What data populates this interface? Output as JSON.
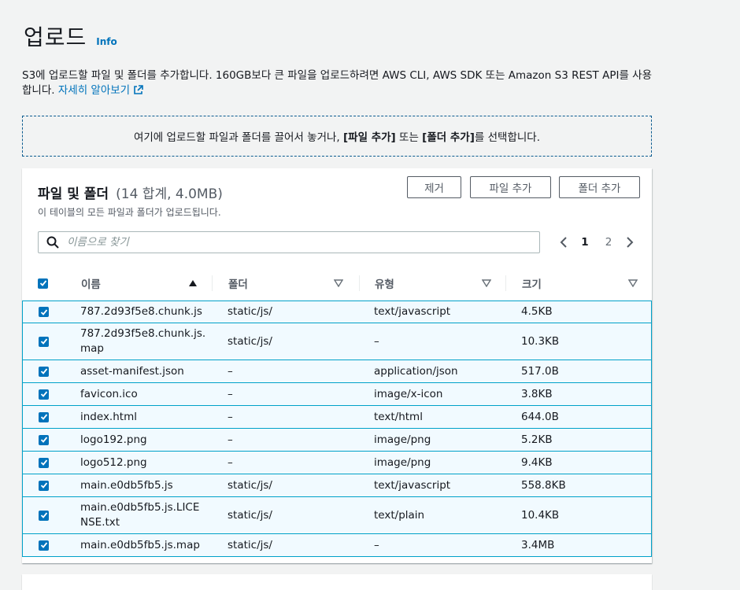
{
  "header": {
    "title": "업로드",
    "info": "Info"
  },
  "description": {
    "text": "S3에 업로드할 파일 및 폴더를 추가합니다. 160GB보다 큰 파일을 업로드하려면 AWS CLI, AWS SDK 또는 Amazon S3 REST API를 사용합니다.",
    "learn_more": "자세히 알아보기"
  },
  "dropzone": {
    "prefix": "여기에 업로드할 파일과 폴더를 끌어서 놓거나, ",
    "file_add": "[파일 추가]",
    "middle": " 또는 ",
    "folder_add": "[폴더 추가]",
    "suffix": "를 선택합니다."
  },
  "panel": {
    "title": "파일 및 폴더",
    "count": "(14 합계, 4.0MB)",
    "subtitle": "이 테이블의 모든 파일과 폴더가 업로드됩니다.",
    "buttons": {
      "remove": "제거",
      "add_files": "파일 추가",
      "add_folder": "폴더 추가"
    },
    "search": {
      "placeholder": "이름으로 찾기",
      "value": ""
    },
    "pagination": {
      "pages": [
        "1",
        "2"
      ],
      "current": "1"
    },
    "columns": {
      "name": "이름",
      "folder": "폴더",
      "type": "유형",
      "size": "크기"
    },
    "rows": [
      {
        "name": "787.2d93f5e8.chunk.js",
        "folder": "static/js/",
        "type": "text/javascript",
        "size": "4.5KB",
        "checked": true
      },
      {
        "name": "787.2d93f5e8.chunk.js.map",
        "folder": "static/js/",
        "type": "–",
        "size": "10.3KB",
        "checked": true
      },
      {
        "name": "asset-manifest.json",
        "folder": "–",
        "type": "application/json",
        "size": "517.0B",
        "checked": true
      },
      {
        "name": "favicon.ico",
        "folder": "–",
        "type": "image/x-icon",
        "size": "3.8KB",
        "checked": true
      },
      {
        "name": "index.html",
        "folder": "–",
        "type": "text/html",
        "size": "644.0B",
        "checked": true
      },
      {
        "name": "logo192.png",
        "folder": "–",
        "type": "image/png",
        "size": "5.2KB",
        "checked": true
      },
      {
        "name": "logo512.png",
        "folder": "–",
        "type": "image/png",
        "size": "9.4KB",
        "checked": true
      },
      {
        "name": "main.e0db5fb5.js",
        "folder": "static/js/",
        "type": "text/javascript",
        "size": "558.8KB",
        "checked": true
      },
      {
        "name": "main.e0db5fb5.js.LICENSE.txt",
        "folder": "static/js/",
        "type": "text/plain",
        "size": "10.4KB",
        "checked": true
      },
      {
        "name": "main.e0db5fb5.js.map",
        "folder": "static/js/",
        "type": "–",
        "size": "3.4MB",
        "checked": true
      }
    ]
  },
  "colors": {
    "accent": "#0073bb",
    "row_selected_bg": "#f1faff",
    "row_selected_border": "#00a1c9"
  }
}
